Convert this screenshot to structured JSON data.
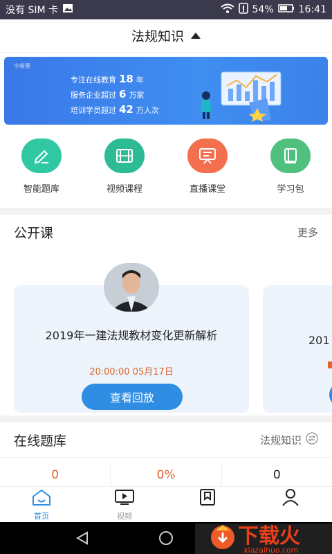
{
  "status_bar": {
    "carrier": "没有 SIM 卡",
    "battery": "54%",
    "time": "16:41"
  },
  "header": {
    "title": "法规知识"
  },
  "banner": {
    "brand": "中希赛",
    "line1_prefix": "专注在线教育",
    "line1_num": "18",
    "line1_suffix": "年",
    "line2_prefix": "服务企业超过",
    "line2_num": "6",
    "line2_suffix": "万家",
    "line3_prefix": "培训学员超过",
    "line3_num": "42",
    "line3_suffix": "万人次"
  },
  "quick_entries": [
    {
      "label": "智能题库",
      "color": "#2fc8a3",
      "icon": "pencil-icon"
    },
    {
      "label": "视频课程",
      "color": "#2dbb93",
      "icon": "film-icon"
    },
    {
      "label": "直播课堂",
      "color": "#f36f4e",
      "icon": "screen-icon"
    },
    {
      "label": "学习包",
      "color": "#4fc07d",
      "icon": "book-icon"
    }
  ],
  "open_courses": {
    "title": "公开课",
    "more": "更多",
    "card": {
      "title": "2019年一建法规教材变化更新解析",
      "time": "20:00:00  05月17日",
      "button": "查看回放"
    },
    "next_card_title": "201"
  },
  "question_bank": {
    "title": "在线题库",
    "subject": "法规知识",
    "stats": [
      "0",
      "0%",
      "0"
    ]
  },
  "tabs": [
    {
      "label": "首页",
      "active": true
    },
    {
      "label": "视频",
      "active": false
    },
    {
      "label": "",
      "active": false
    },
    {
      "label": "",
      "active": false
    }
  ],
  "watermark": {
    "text": "下载火",
    "site": "xiazaihuo.com"
  },
  "colors": {
    "accent": "#2f8de4",
    "orange": "#e0632a"
  }
}
